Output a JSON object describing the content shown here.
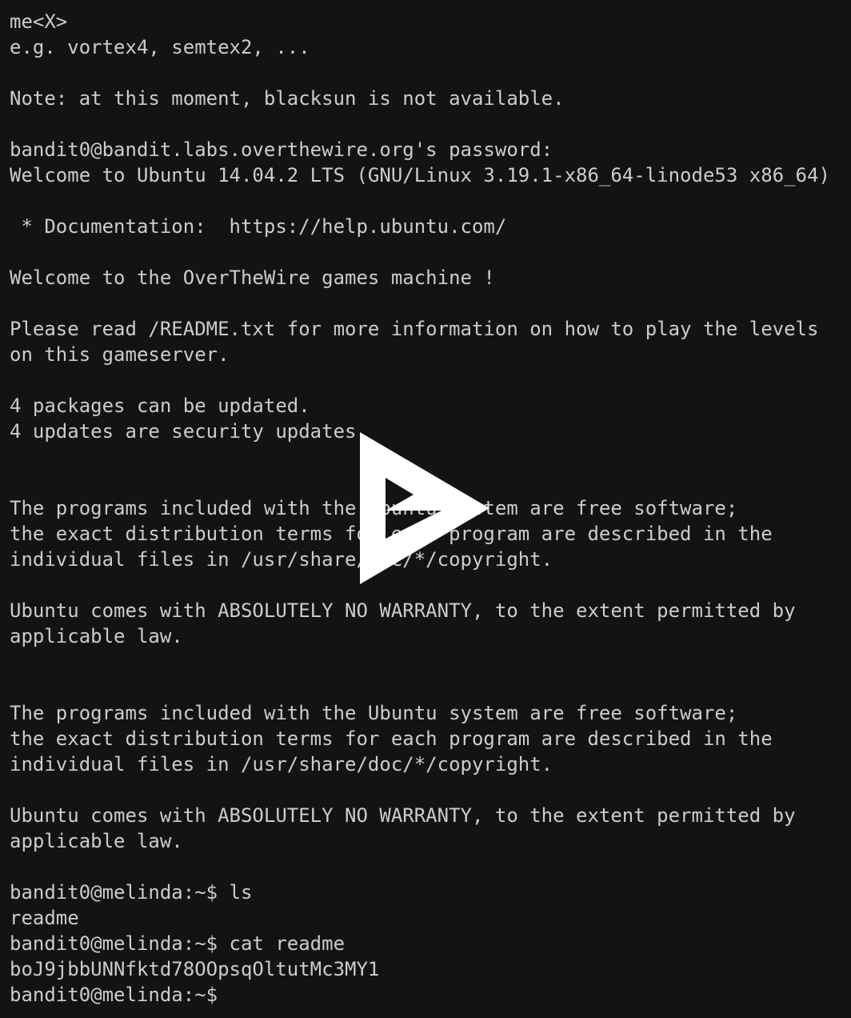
{
  "terminal": {
    "lines": [
      "me<X>",
      "e.g. vortex4, semtex2, ...",
      "",
      "Note: at this moment, blacksun is not available.",
      "",
      "bandit0@bandit.labs.overthewire.org's password:",
      "Welcome to Ubuntu 14.04.2 LTS (GNU/Linux 3.19.1-x86_64-linode53 x86_64)",
      "",
      " * Documentation:  https://help.ubuntu.com/",
      "",
      "Welcome to the OverTheWire games machine !",
      "",
      "Please read /README.txt for more information on how to play the levels",
      "on this gameserver.",
      "",
      "4 packages can be updated.",
      "4 updates are security updates.",
      "",
      "",
      "The programs included with the Ubuntu system are free software;",
      "the exact distribution terms for each program are described in the",
      "individual files in /usr/share/doc/*/copyright.",
      "",
      "Ubuntu comes with ABSOLUTELY NO WARRANTY, to the extent permitted by",
      "applicable law.",
      "",
      "",
      "The programs included with the Ubuntu system are free software;",
      "the exact distribution terms for each program are described in the",
      "individual files in /usr/share/doc/*/copyright.",
      "",
      "Ubuntu comes with ABSOLUTELY NO WARRANTY, to the extent permitted by",
      "applicable law.",
      "",
      "bandit0@melinda:~$ ls",
      "readme",
      "bandit0@melinda:~$ cat readme",
      "boJ9jbbUNNfktd78OOpsqOltutMc3MY1",
      "bandit0@melinda:~$"
    ]
  },
  "player": {
    "icon": "play-icon",
    "color": "#ffffff",
    "background": "#121314",
    "text_color": "#cccccc"
  }
}
